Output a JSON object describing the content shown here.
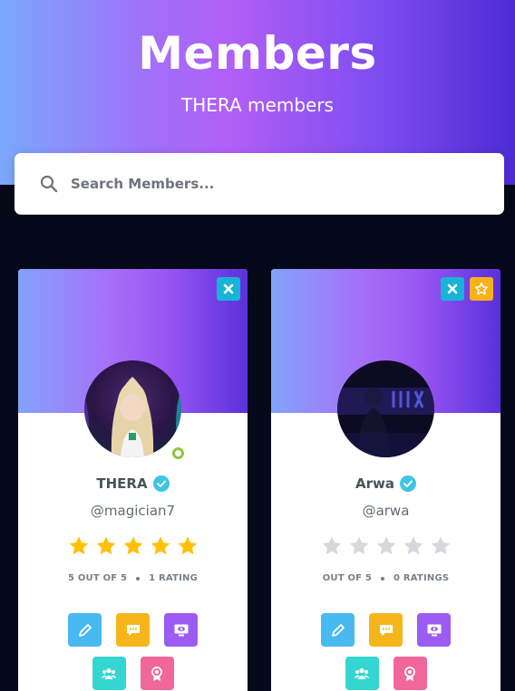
{
  "header": {
    "title": "Members",
    "subtitle": "THERA members"
  },
  "search": {
    "placeholder": "Search Members...",
    "value": ""
  },
  "members": [
    {
      "name": "THERA",
      "handle": "@magician7",
      "verified": true,
      "online": true,
      "rating_stars": 5,
      "rating_summary": "5 OUT OF 5",
      "rating_count": "1 RATING",
      "cover_actions": [
        "close-icon"
      ]
    },
    {
      "name": "Arwa",
      "handle": "@arwa",
      "verified": true,
      "online": false,
      "rating_stars": 0,
      "rating_summary": "OUT OF 5",
      "rating_count": "0 RATINGS",
      "cover_actions": [
        "close-icon",
        "star-icon"
      ]
    }
  ],
  "action_buttons": [
    {
      "icon": "pencil-icon",
      "color": "#49b9f2"
    },
    {
      "icon": "chat-icon",
      "color": "#f7b51c"
    },
    {
      "icon": "monitor-eye-icon",
      "color": "#9c5cf4"
    },
    {
      "icon": "group-icon",
      "color": "#35d6d1"
    },
    {
      "icon": "award-icon",
      "color": "#f0679a"
    }
  ],
  "colors": {
    "star_filled": "#ffc107",
    "star_empty": "#d6d8db",
    "verified": "#3ec5e6",
    "online": "#8cc63f"
  }
}
